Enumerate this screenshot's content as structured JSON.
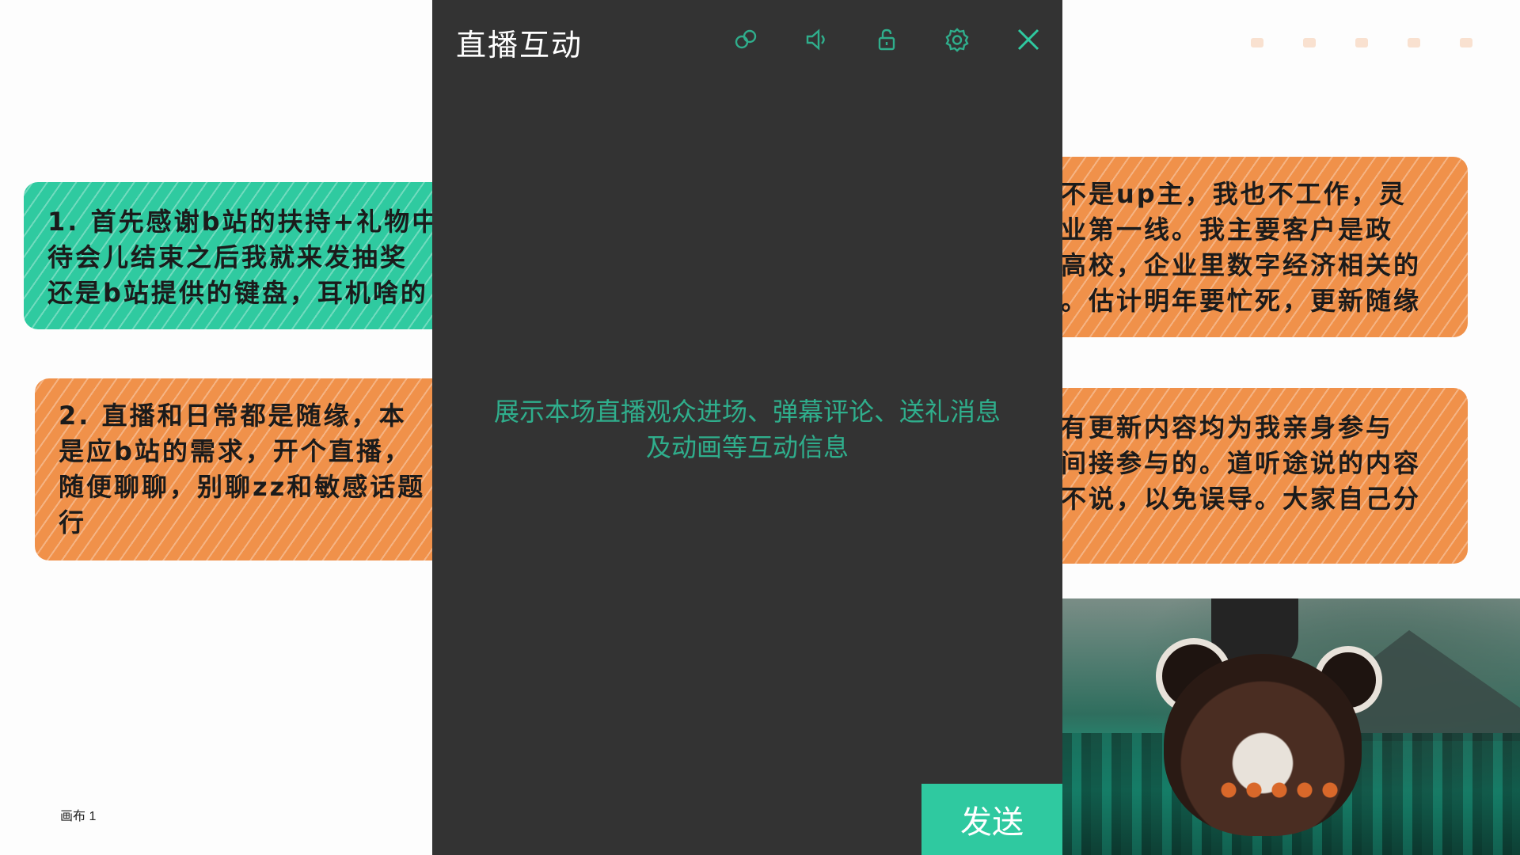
{
  "canvas": {
    "label": "画布 1",
    "notes": [
      {
        "id": "note-1",
        "color": "#2fcaa0",
        "lines": [
          "1. 首先感谢b站的扶持+礼物中",
          "待会儿结束之后我就来发抽奖",
          "还是b站提供的键盘，耳机啥的"
        ]
      },
      {
        "id": "note-2",
        "color": "#f0914a",
        "lines": [
          "2. 直播和日常都是随缘，本",
          "是应b站的需求，开个直播，",
          "随便聊聊，别聊zz和敏感话题",
          "行"
        ]
      },
      {
        "id": "note-3",
        "color": "#f0914a",
        "lines": [
          "不是up主，我也不工作，灵",
          "业第一线。我主要客户是政",
          "高校，企业里数字经济相关的",
          "。估计明年要忙死，更新随缘"
        ]
      },
      {
        "id": "note-4",
        "color": "#f0914a",
        "lines": [
          "有更新内容均为我亲身参与",
          "间接参与的。道听途说的内容",
          "不说，以免误导。大家自己分",
          ""
        ]
      }
    ]
  },
  "panel": {
    "title": "直播互动",
    "placeholder_line1": "展示本场直播观众进场、弹幕评论、送礼消息",
    "placeholder_line2": "及动画等互动信息",
    "send_label": "发送",
    "accent": "#2fc9a0",
    "background": "#333333",
    "tools": [
      "dual-screen-icon",
      "sound-icon",
      "lock-icon",
      "gear-icon",
      "close-icon"
    ]
  }
}
